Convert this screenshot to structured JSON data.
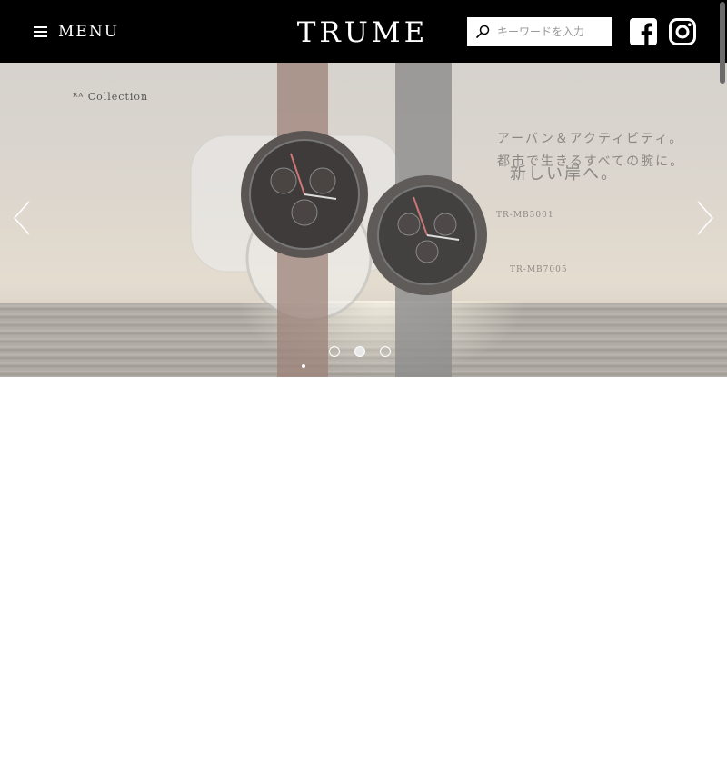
{
  "header": {
    "menu_label": "MENU",
    "logo_text": "TRUME",
    "search": {
      "placeholder": "キーワードを入力",
      "value": ""
    },
    "social": [
      "facebook-icon",
      "instagram-icon"
    ],
    "background": "#000000"
  },
  "hero": {
    "collection_label": "Collection",
    "copy_line1": "アーバン＆アクティビティ。",
    "copy_line2": "都市で生きるすべての腕に。",
    "copy_line3": "新しい岸へ。",
    "model_1": "TR-MB5001",
    "model_2": "TR-MB7005",
    "slider": {
      "slide_count": 3,
      "active_index": 1
    }
  },
  "icons": {
    "menu": "hamburger-icon",
    "search": "search-icon",
    "prev": "chevron-left-icon",
    "next": "chevron-right-icon"
  },
  "colors": {
    "header_bg": "#000000",
    "text_on_dark": "#ffffff",
    "hero_text": "#8a8784"
  }
}
